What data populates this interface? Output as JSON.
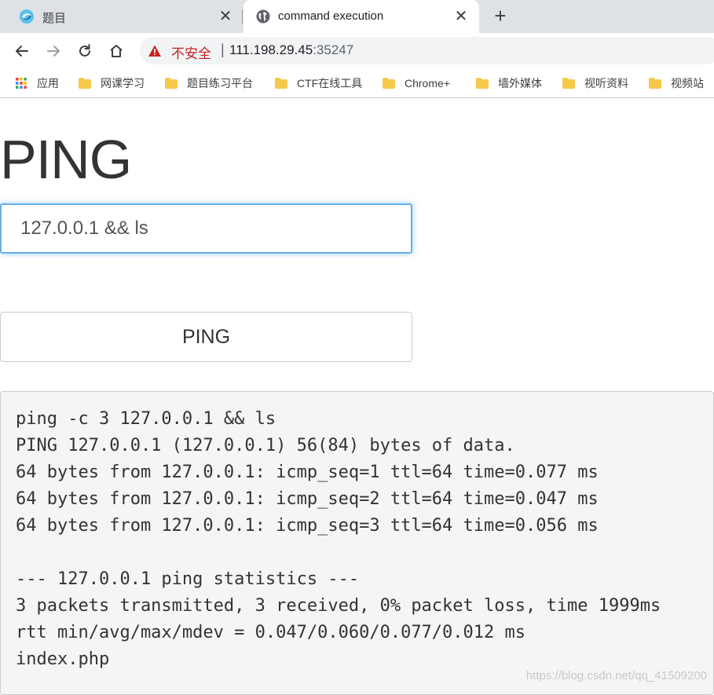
{
  "browser": {
    "tabs": [
      {
        "title": "题目",
        "favicon": "swirl-logo-icon",
        "close": "✕"
      },
      {
        "title": "command execution",
        "favicon": "globe-icon",
        "close": "✕"
      }
    ],
    "new_tab": "+",
    "address": {
      "security_label": "不安全",
      "divider": "|",
      "host": "111.198.29.45",
      "port": ":35247"
    },
    "bookmarks": [
      {
        "label": "应用",
        "icon": "apps-grid-icon"
      },
      {
        "label": "网课学习",
        "icon": "folder-icon"
      },
      {
        "label": "题目练习平台",
        "icon": "folder-icon"
      },
      {
        "label": "CTF在线工具",
        "icon": "folder-icon"
      },
      {
        "label": "Chrome+",
        "icon": "folder-icon"
      },
      {
        "label": "墙外媒体",
        "icon": "folder-icon"
      },
      {
        "label": "视听资料",
        "icon": "folder-icon"
      },
      {
        "label": "视频站",
        "icon": "folder-icon"
      }
    ]
  },
  "page": {
    "title": "PING",
    "input_value": "127.0.0.1 && ls",
    "button_label": "PING",
    "output_lines": [
      "ping -c 3 127.0.0.1 && ls",
      "PING 127.0.0.1 (127.0.0.1) 56(84) bytes of data.",
      "64 bytes from 127.0.0.1: icmp_seq=1 ttl=64 time=0.077 ms",
      "64 bytes from 127.0.0.1: icmp_seq=2 ttl=64 time=0.047 ms",
      "64 bytes from 127.0.0.1: icmp_seq=3 ttl=64 time=0.056 ms",
      "",
      "--- 127.0.0.1 ping statistics ---",
      "3 packets transmitted, 3 received, 0% packet loss, time 1999ms",
      "rtt min/avg/max/mdev = 0.047/0.060/0.077/0.012 ms",
      "index.php"
    ],
    "watermark": "https://blog.csdn.net/qq_41509200"
  },
  "colors": {
    "tabstrip": "#dee1e6",
    "insecure": "#c5221f",
    "input_focus": "#66afe9",
    "output_bg": "#f5f5f5"
  }
}
